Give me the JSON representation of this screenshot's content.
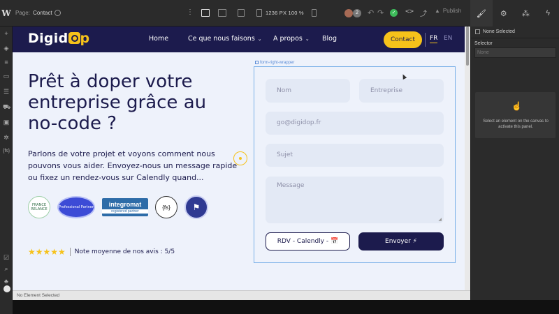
{
  "editor": {
    "logo": "W",
    "page_key": "Page:",
    "page_name": "Contact",
    "canvas_size": "1236 PX  100 %",
    "avatar_count": "2",
    "publish": "Publish",
    "status_bar": "No Element Selected"
  },
  "right_panel": {
    "none_selected": "None Selected",
    "selector_label": "Selector",
    "selector_placeholder": "None",
    "hint": "Select an element on the canvas to activate this panel."
  },
  "site": {
    "logo_left": "Digid",
    "logo_right": "p",
    "nav": {
      "home": "Home",
      "what_we_do": "Ce que nous faisons",
      "about": "A propos",
      "blog": "Blog",
      "contact": "Contact",
      "lang_fr": "FR",
      "lang_en": "EN"
    },
    "hero_title": "Prêt à doper votre entreprise grâce au no-code ?",
    "hero_text": "Parlons de votre projet et voyons comment nous pouvons vous aider. Envoyez-nous un message rapide ou fixez un rendez-vous sur Calendly quand...",
    "badges": {
      "france_relance": "FRANCE RELANCE",
      "professional_partner": "Professional Partner",
      "integromat_name": "integromat",
      "integromat_sub": "registered partner",
      "fs": "{fs}"
    },
    "rating_stars": "★★★★★",
    "rating_text": "Note moyenne de nos avis : 5/5",
    "form": {
      "wrapper_label": "form-right-wrapper",
      "nom": "Nom",
      "entreprise": "Entreprise",
      "email": "go@digidop.fr",
      "sujet": "Sujet",
      "message": "Message",
      "rdv_button": "RDV - Calendly - 📅",
      "send_button": "Envoyer ⚡"
    }
  },
  "colors": {
    "brand_navy": "#1c1b4d",
    "brand_yellow": "#f6c21a",
    "canvas_bg": "#eef2fb",
    "field_bg": "#e3e9f5"
  }
}
